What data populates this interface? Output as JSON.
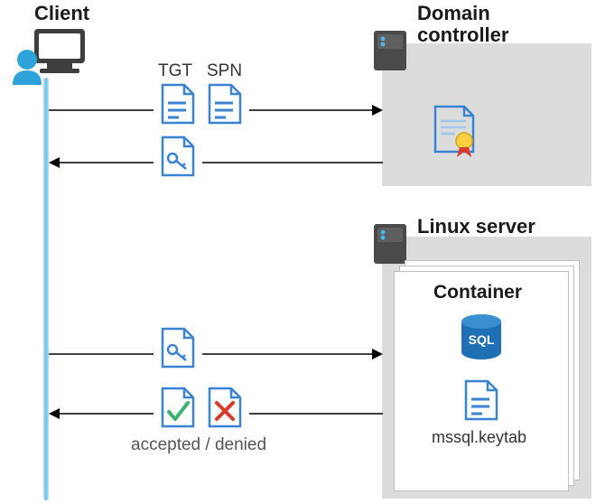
{
  "labels": {
    "client": "Client",
    "tgt": "TGT",
    "spn": "SPN",
    "dc_line1": "Domain",
    "dc_line2": "controller",
    "linux": "Linux server",
    "container": "Container",
    "keytab": "mssql.keytab",
    "accepted_denied": "accepted / denied",
    "sql": "SQL"
  },
  "flows": [
    {
      "step": 1,
      "from": "Client",
      "to": "Domain controller",
      "payload": [
        "TGT",
        "SPN"
      ],
      "arrow_direction": "right"
    },
    {
      "step": 2,
      "from": "Domain controller",
      "to": "Client",
      "payload": [
        "service-ticket"
      ],
      "arrow_direction": "left"
    },
    {
      "step": 3,
      "from": "Client",
      "to": "Linux server container",
      "payload": [
        "service-ticket"
      ],
      "arrow_direction": "right"
    },
    {
      "step": 4,
      "from": "Linux server container",
      "to": "Client",
      "payload": [
        "accepted",
        "denied"
      ],
      "arrow_direction": "left"
    }
  ],
  "nodes": {
    "client": {
      "role": "user workstation"
    },
    "domain_controller": {
      "holds": "certificate / KDC"
    },
    "linux_server": {
      "runs": "container",
      "container_has": [
        "SQL Server",
        "mssql.keytab"
      ]
    }
  },
  "colors": {
    "doc_blue": "#3b82d4",
    "light_blue": "#9ec7eb",
    "gray_box": "#dcdcdc",
    "green": "#3cb371",
    "red": "#d93a2b",
    "sql_blue": "#1f6fb5"
  }
}
